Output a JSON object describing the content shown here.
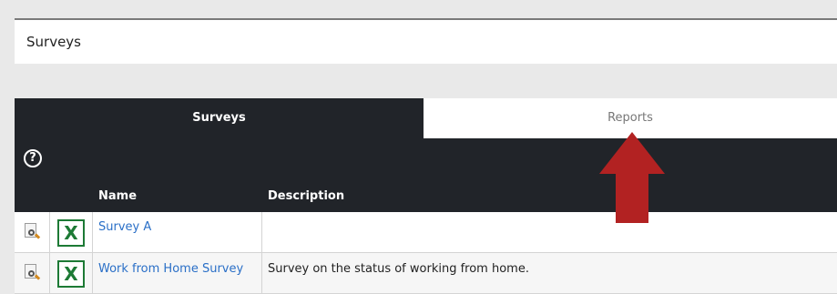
{
  "header": {
    "title": "Surveys"
  },
  "tabs": [
    {
      "label": "Surveys",
      "active": true
    },
    {
      "label": "Reports",
      "active": false
    }
  ],
  "help": {
    "symbol": "?"
  },
  "table": {
    "columns": {
      "name": "Name",
      "description": "Description"
    },
    "rows": [
      {
        "name": "Survey A",
        "description": ""
      },
      {
        "name": "Work from Home Survey",
        "description": "Survey on the status of working from home."
      }
    ],
    "xl_glyph": "X"
  },
  "colors": {
    "panel": "#212429",
    "link": "#2a6fc7",
    "arrow": "#b22222",
    "excel": "#1d7a35"
  },
  "icons": [
    "help-icon",
    "view-document-icon",
    "excel-icon",
    "arrow-up-annotation"
  ]
}
